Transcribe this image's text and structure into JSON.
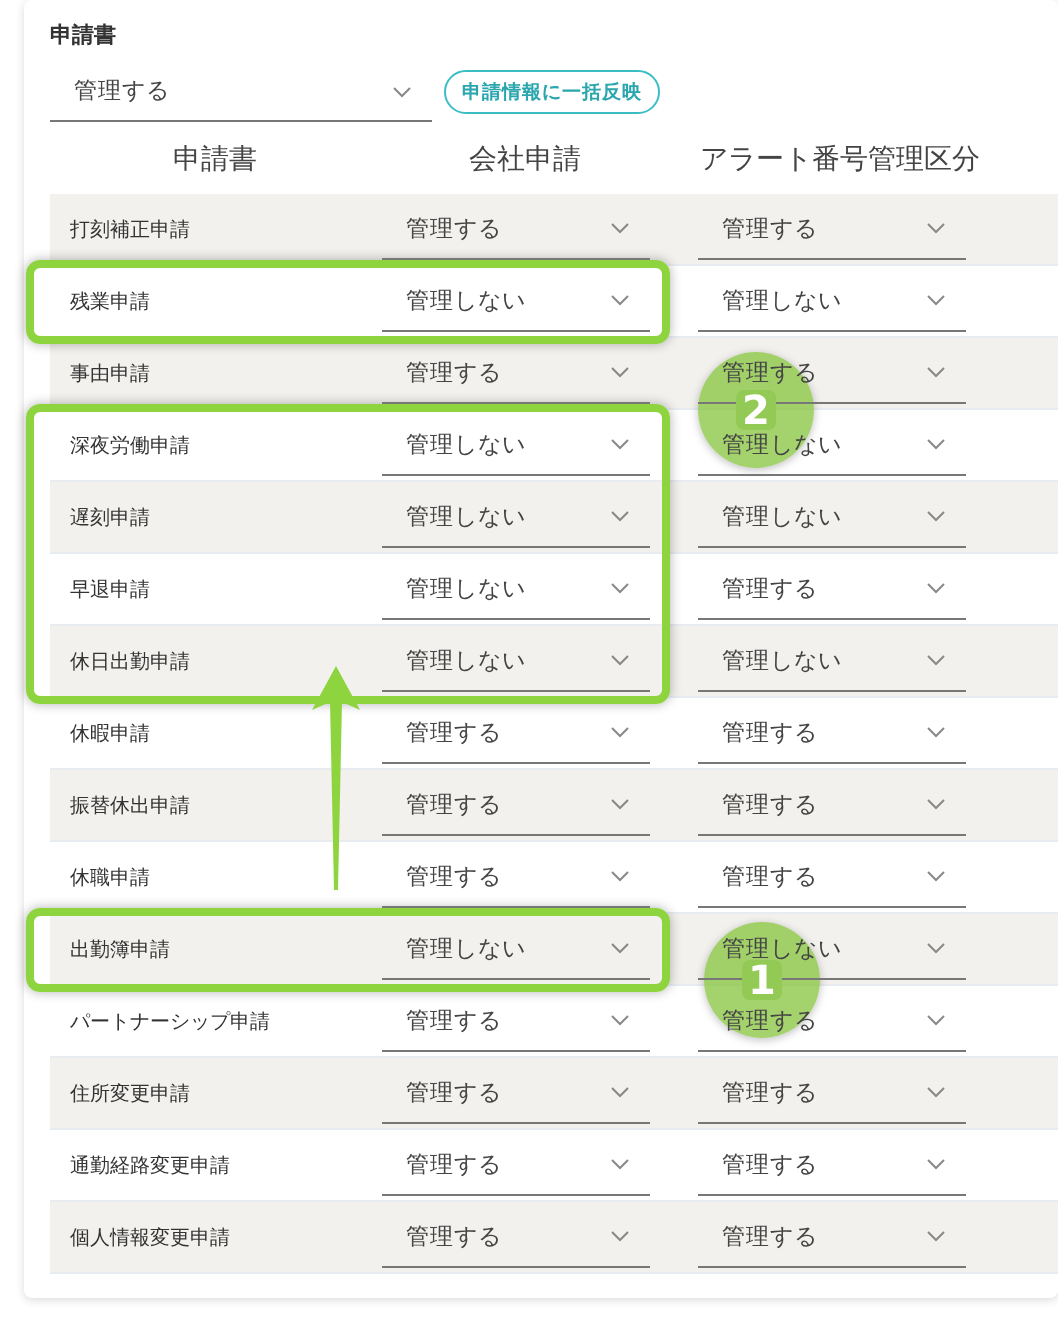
{
  "section_title": "申請書",
  "bulk": {
    "value": "管理する",
    "button": "申請情報に一括反映"
  },
  "table": {
    "columns": [
      "申請書",
      "会社申請",
      "アラート番号管理区分"
    ],
    "rows": [
      {
        "name": "打刻補正申請",
        "company": "管理する",
        "alert": "管理する",
        "highlighted": false
      },
      {
        "name": "残業申請",
        "company": "管理しない",
        "alert": "管理しない",
        "highlighted": true
      },
      {
        "name": "事由申請",
        "company": "管理する",
        "alert": "管理する",
        "highlighted": false
      },
      {
        "name": "深夜労働申請",
        "company": "管理しない",
        "alert": "管理しない",
        "highlighted": true
      },
      {
        "name": "遅刻申請",
        "company": "管理しない",
        "alert": "管理しない",
        "highlighted": true
      },
      {
        "name": "早退申請",
        "company": "管理しない",
        "alert": "管理する",
        "highlighted": true
      },
      {
        "name": "休日出勤申請",
        "company": "管理しない",
        "alert": "管理しない",
        "highlighted": true
      },
      {
        "name": "休暇申請",
        "company": "管理する",
        "alert": "管理する",
        "highlighted": false
      },
      {
        "name": "振替休出申請",
        "company": "管理する",
        "alert": "管理する",
        "highlighted": false
      },
      {
        "name": "休職申請",
        "company": "管理する",
        "alert": "管理する",
        "highlighted": false
      },
      {
        "name": "出勤簿申請",
        "company": "管理しない",
        "alert": "管理しない",
        "highlighted": true
      },
      {
        "name": "パートナーシップ申請",
        "company": "管理する",
        "alert": "管理する",
        "highlighted": false
      },
      {
        "name": "住所変更申請",
        "company": "管理する",
        "alert": "管理する",
        "highlighted": false
      },
      {
        "name": "通勤経路変更申請",
        "company": "管理する",
        "alert": "管理する",
        "highlighted": false
      },
      {
        "name": "個人情報変更申請",
        "company": "管理する",
        "alert": "管理する",
        "highlighted": false
      }
    ]
  },
  "markers": [
    {
      "label": "2"
    },
    {
      "label": "1"
    }
  ]
}
